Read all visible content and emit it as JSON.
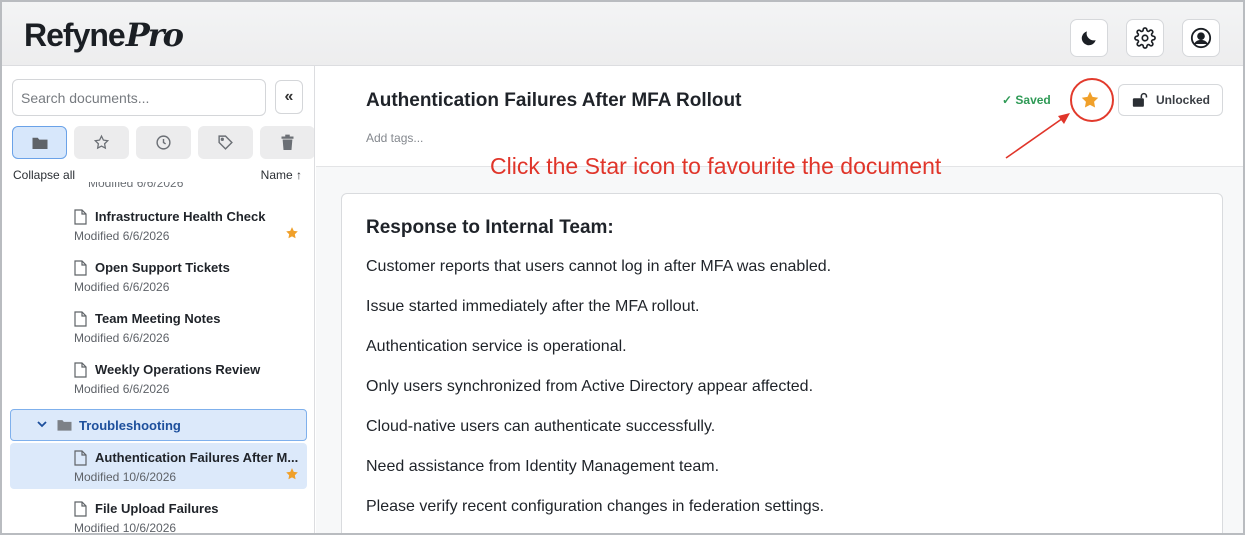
{
  "app": {
    "logo_main": "Refyne",
    "logo_accent": "Pro"
  },
  "toolbar": {
    "theme_icon": "moon-icon",
    "settings_icon": "gear-icon",
    "profile_icon": "user-circle-icon"
  },
  "sidebar": {
    "search_placeholder": "Search documents...",
    "collapse_label": "«",
    "tabs": [
      {
        "icon": "folder-icon",
        "active": true
      },
      {
        "icon": "star-icon",
        "active": false
      },
      {
        "icon": "clock-icon",
        "active": false
      },
      {
        "icon": "tag-icon",
        "active": false
      },
      {
        "icon": "trash-icon",
        "active": false
      }
    ],
    "collapse_all": "Collapse all",
    "sort_label": "Name ↑",
    "clipped_modified": "Modified 6/6/2026",
    "documents_before": [
      {
        "name": "Infrastructure Health Check",
        "modified": "Modified 6/6/2026",
        "starred": true
      },
      {
        "name": "Open Support Tickets",
        "modified": "Modified 6/6/2026",
        "starred": false
      },
      {
        "name": "Team Meeting Notes",
        "modified": "Modified 6/6/2026",
        "starred": false
      },
      {
        "name": "Weekly Operations Review",
        "modified": "Modified 6/6/2026",
        "starred": false
      }
    ],
    "folder": {
      "name": "Troubleshooting",
      "expanded": true
    },
    "documents_after": [
      {
        "name": "Authentication Failures After M...",
        "modified": "Modified 10/6/2026",
        "starred": true,
        "selected": true
      },
      {
        "name": "File Upload Failures",
        "modified": "Modified 10/6/2026",
        "starred": false,
        "selected": false
      }
    ]
  },
  "document": {
    "title": "Authentication Failures After MFA Rollout",
    "tags_placeholder": "Add tags...",
    "status": "✓ Saved",
    "lock_label": "Unlocked",
    "starred": true,
    "heading": "Response to Internal Team:",
    "paragraphs": [
      "Customer reports that users cannot log in after MFA was enabled.",
      "Issue started immediately after the MFA rollout.",
      "Authentication service is operational.",
      "Only users synchronized from Active Directory appear affected.",
      "Cloud-native users can authenticate successfully.",
      "Need assistance from Identity Management team.",
      "Please verify recent configuration changes in federation settings."
    ]
  },
  "annotation": {
    "text": "Click the Star icon to favourite the document",
    "color": "#e0352a"
  },
  "colors": {
    "accent": "#6aa2e8",
    "star": "#f0a02a",
    "saved": "#2f9a56"
  }
}
